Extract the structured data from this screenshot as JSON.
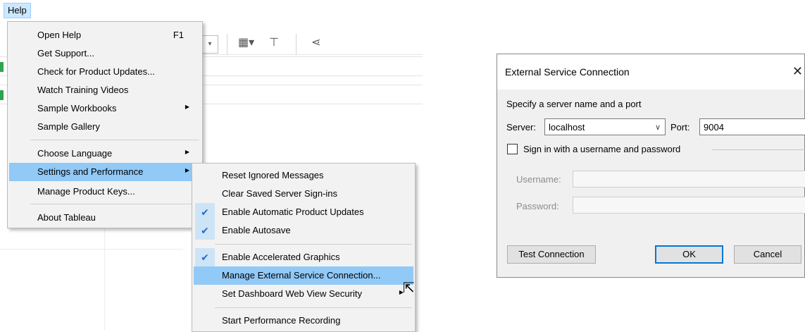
{
  "menubar": {
    "help_label": "Help"
  },
  "main_menu": {
    "items": [
      {
        "label": "Open Help",
        "accel": "F1"
      },
      {
        "label": "Get Support..."
      },
      {
        "label": "Check for Product Updates..."
      },
      {
        "label": "Watch Training Videos"
      },
      {
        "label": "Sample Workbooks"
      },
      {
        "label": "Sample Gallery"
      },
      {
        "label": "Choose Language"
      },
      {
        "label": "Settings and Performance"
      },
      {
        "label": "Manage Product Keys..."
      },
      {
        "label": "About Tableau"
      }
    ]
  },
  "sub_menu": {
    "items": [
      {
        "label": "Reset Ignored Messages",
        "checked": false
      },
      {
        "label": "Clear Saved Server Sign-ins",
        "checked": false
      },
      {
        "label": "Enable Automatic Product Updates",
        "checked": true
      },
      {
        "label": "Enable Autosave",
        "checked": true
      },
      {
        "label": "Enable Accelerated Graphics",
        "checked": true
      },
      {
        "label": "Manage External Service Connection...",
        "checked": false
      },
      {
        "label": "Set Dashboard Web View Security",
        "checked": false
      },
      {
        "label": "Start Performance Recording",
        "checked": false
      }
    ]
  },
  "dialog": {
    "title": "External Service Connection",
    "instruction": "Specify a server name and a port",
    "server_label": "Server:",
    "server_value": "localhost",
    "port_label": "Port:",
    "port_value": "9004",
    "signin_label": "Sign in with a username and password",
    "signin_checked": false,
    "username_label": "Username:",
    "password_label": "Password:",
    "test_button": "Test Connection",
    "ok_button": "OK",
    "cancel_button": "Cancel"
  },
  "colors": {
    "highlight": "#91c9f7",
    "check_bg": "#cde4f7",
    "default_button_border": "#0078d7"
  }
}
